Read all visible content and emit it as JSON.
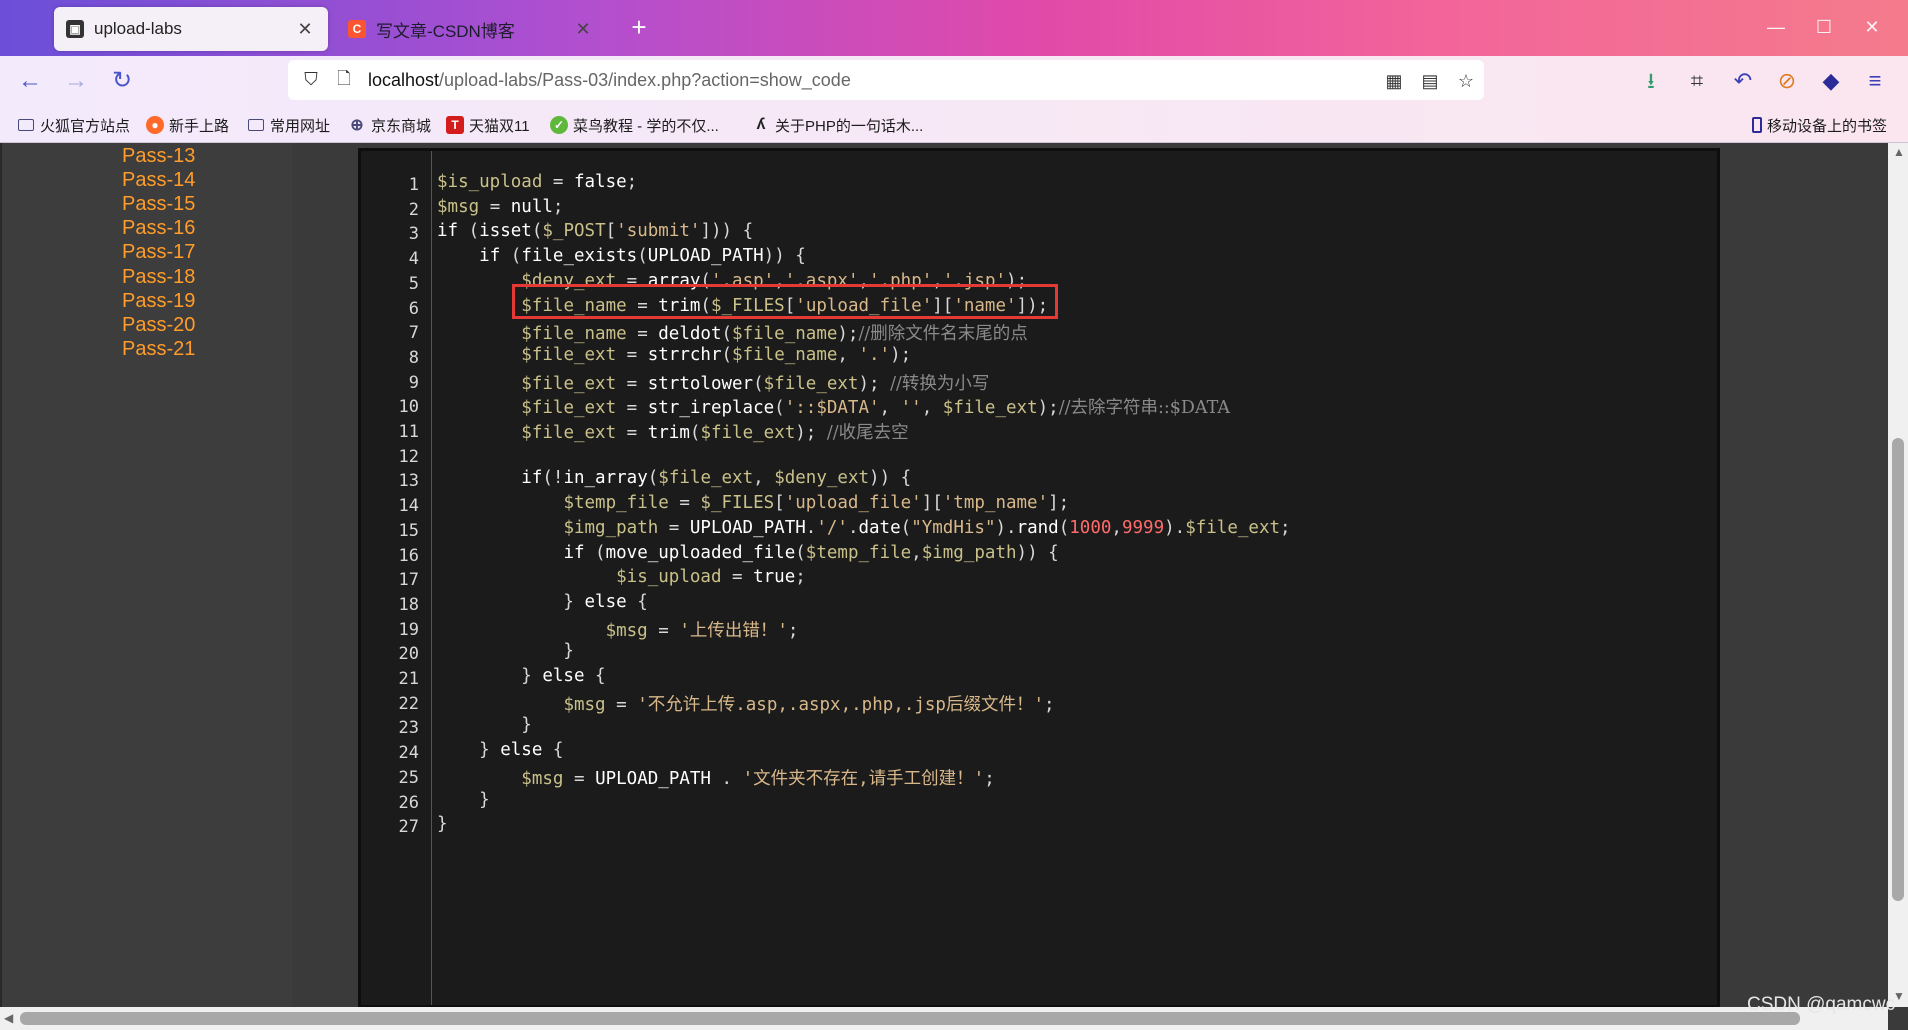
{
  "tabs": [
    {
      "label": "upload-labs",
      "active": true
    },
    {
      "label": "写文章-CSDN博客",
      "active": false
    }
  ],
  "nav": {
    "url_host": "localhost",
    "url_path": "/upload-labs/Pass-03/index.php?action=show_code"
  },
  "bookmarks": [
    {
      "label": "火狐官方站点",
      "icon": "folder-icon"
    },
    {
      "label": "新手上路",
      "icon": "firefox-icon"
    },
    {
      "label": "常用网址",
      "icon": "folder-icon"
    },
    {
      "label": "京东商城",
      "icon": "globe-icon"
    },
    {
      "label": "天猫双11",
      "icon": "tmall-icon"
    },
    {
      "label": "菜鸟教程 - 学的不仅...",
      "icon": "runoob-icon"
    },
    {
      "label": "关于PHP的一句话木...",
      "icon": "wolf-icon"
    },
    {
      "label": "移动设备上的书签",
      "icon": "mobile-icon"
    }
  ],
  "sidebar": {
    "items": [
      "Pass-13",
      "Pass-14",
      "Pass-15",
      "Pass-16",
      "Pass-17",
      "Pass-18",
      "Pass-19",
      "Pass-20",
      "Pass-21"
    ]
  },
  "code": {
    "line_numbers": [
      "1",
      "2",
      "3",
      "4",
      "5",
      "6",
      "7",
      "8",
      "9",
      "10",
      "11",
      "12",
      "13",
      "14",
      "15",
      "16",
      "17",
      "18",
      "19",
      "20",
      "21",
      "22",
      "23",
      "24",
      "25",
      "26",
      "27"
    ],
    "lines": [
      [
        [
          "v",
          "$is_upload"
        ],
        [
          "p",
          " = "
        ],
        [
          "k",
          "false"
        ],
        [
          "p",
          ";"
        ]
      ],
      [
        [
          "v",
          "$msg"
        ],
        [
          "p",
          " = "
        ],
        [
          "k",
          "null"
        ],
        [
          "p",
          ";"
        ]
      ],
      [
        [
          "k",
          "if"
        ],
        [
          "p",
          " ("
        ],
        [
          "k",
          "isset"
        ],
        [
          "p",
          "("
        ],
        [
          "v",
          "$_POST"
        ],
        [
          "p",
          "["
        ],
        [
          "s",
          "'submit'"
        ],
        [
          "p",
          "])) {"
        ]
      ],
      [
        [
          "p",
          "    "
        ],
        [
          "k",
          "if"
        ],
        [
          "p",
          " ("
        ],
        [
          "k",
          "file_exists"
        ],
        [
          "p",
          "("
        ],
        [
          "k",
          "UPLOAD_PATH"
        ],
        [
          "p",
          ")) {"
        ]
      ],
      [
        [
          "p",
          "        "
        ],
        [
          "v",
          "$deny_ext"
        ],
        [
          "p",
          " = "
        ],
        [
          "k",
          "array"
        ],
        [
          "p",
          "("
        ],
        [
          "s",
          "'.asp'"
        ],
        [
          "p",
          ","
        ],
        [
          "s",
          "'.aspx'"
        ],
        [
          "p",
          ","
        ],
        [
          "s",
          "'.php'"
        ],
        [
          "p",
          ","
        ],
        [
          "s",
          "'.jsp'"
        ],
        [
          "p",
          ");"
        ]
      ],
      [
        [
          "p",
          "        "
        ],
        [
          "v",
          "$file_name"
        ],
        [
          "p",
          " = "
        ],
        [
          "k",
          "trim"
        ],
        [
          "p",
          "("
        ],
        [
          "v",
          "$_FILES"
        ],
        [
          "p",
          "["
        ],
        [
          "s",
          "'upload_file'"
        ],
        [
          "p",
          "]["
        ],
        [
          "s",
          "'name'"
        ],
        [
          "p",
          "]);"
        ]
      ],
      [
        [
          "p",
          "        "
        ],
        [
          "v",
          "$file_name"
        ],
        [
          "p",
          " = "
        ],
        [
          "k",
          "deldot"
        ],
        [
          "p",
          "("
        ],
        [
          "v",
          "$file_name"
        ],
        [
          "p",
          ");"
        ],
        [
          "c",
          "//删除文件名末尾的点"
        ]
      ],
      [
        [
          "p",
          "        "
        ],
        [
          "v",
          "$file_ext"
        ],
        [
          "p",
          " = "
        ],
        [
          "k",
          "strrchr"
        ],
        [
          "p",
          "("
        ],
        [
          "v",
          "$file_name"
        ],
        [
          "p",
          ", "
        ],
        [
          "s",
          "'.'"
        ],
        [
          "p",
          ");"
        ]
      ],
      [
        [
          "p",
          "        "
        ],
        [
          "v",
          "$file_ext"
        ],
        [
          "p",
          " = "
        ],
        [
          "k",
          "strtolower"
        ],
        [
          "p",
          "("
        ],
        [
          "v",
          "$file_ext"
        ],
        [
          "p",
          "); "
        ],
        [
          "c",
          "//转换为小写"
        ]
      ],
      [
        [
          "p",
          "        "
        ],
        [
          "v",
          "$file_ext"
        ],
        [
          "p",
          " = "
        ],
        [
          "k",
          "str_ireplace"
        ],
        [
          "p",
          "("
        ],
        [
          "s",
          "'::$DATA'"
        ],
        [
          "p",
          ", "
        ],
        [
          "s",
          "''"
        ],
        [
          "p",
          ", "
        ],
        [
          "v",
          "$file_ext"
        ],
        [
          "p",
          ");"
        ],
        [
          "c",
          "//去除字符串::$DATA"
        ]
      ],
      [
        [
          "p",
          "        "
        ],
        [
          "v",
          "$file_ext"
        ],
        [
          "p",
          " = "
        ],
        [
          "k",
          "trim"
        ],
        [
          "p",
          "("
        ],
        [
          "v",
          "$file_ext"
        ],
        [
          "p",
          "); "
        ],
        [
          "c",
          "//收尾去空"
        ]
      ],
      [],
      [
        [
          "p",
          "        "
        ],
        [
          "k",
          "if"
        ],
        [
          "p",
          "(!"
        ],
        [
          "k",
          "in_array"
        ],
        [
          "p",
          "("
        ],
        [
          "v",
          "$file_ext"
        ],
        [
          "p",
          ", "
        ],
        [
          "v",
          "$deny_ext"
        ],
        [
          "p",
          ")) {"
        ]
      ],
      [
        [
          "p",
          "            "
        ],
        [
          "v",
          "$temp_file"
        ],
        [
          "p",
          " = "
        ],
        [
          "v",
          "$_FILES"
        ],
        [
          "p",
          "["
        ],
        [
          "s",
          "'upload_file'"
        ],
        [
          "p",
          "]["
        ],
        [
          "s",
          "'tmp_name'"
        ],
        [
          "p",
          "];"
        ]
      ],
      [
        [
          "p",
          "            "
        ],
        [
          "v",
          "$img_path"
        ],
        [
          "p",
          " = "
        ],
        [
          "k",
          "UPLOAD_PATH"
        ],
        [
          "p",
          "."
        ],
        [
          "s",
          "'/'"
        ],
        [
          "p",
          "."
        ],
        [
          "k",
          "date"
        ],
        [
          "p",
          "("
        ],
        [
          "s",
          "\"YmdHis\""
        ],
        [
          "p",
          ")."
        ],
        [
          "k",
          "rand"
        ],
        [
          "p",
          "("
        ],
        [
          "n",
          "1000"
        ],
        [
          "p",
          ","
        ],
        [
          "n",
          "9999"
        ],
        [
          "p",
          ")."
        ],
        [
          "v",
          "$file_ext"
        ],
        [
          "p",
          ";"
        ]
      ],
      [
        [
          "p",
          "            "
        ],
        [
          "k",
          "if"
        ],
        [
          "p",
          " ("
        ],
        [
          "k",
          "move_uploaded_file"
        ],
        [
          "p",
          "("
        ],
        [
          "v",
          "$temp_file"
        ],
        [
          "p",
          ","
        ],
        [
          "v",
          "$img_path"
        ],
        [
          "p",
          ")) {"
        ]
      ],
      [
        [
          "p",
          "                 "
        ],
        [
          "v",
          "$is_upload"
        ],
        [
          "p",
          " = "
        ],
        [
          "k",
          "true"
        ],
        [
          "p",
          ";"
        ]
      ],
      [
        [
          "p",
          "            } "
        ],
        [
          "k",
          "else"
        ],
        [
          "p",
          " {"
        ]
      ],
      [
        [
          "p",
          "                "
        ],
        [
          "v",
          "$msg"
        ],
        [
          "p",
          " = "
        ],
        [
          "s",
          "'上传出错！'"
        ],
        [
          "p",
          ";"
        ]
      ],
      [
        [
          "p",
          "            }"
        ]
      ],
      [
        [
          "p",
          "        } "
        ],
        [
          "k",
          "else"
        ],
        [
          "p",
          " {"
        ]
      ],
      [
        [
          "p",
          "            "
        ],
        [
          "v",
          "$msg"
        ],
        [
          "p",
          " = "
        ],
        [
          "s",
          "'不允许上传.asp,.aspx,.php,.jsp后缀文件！'"
        ],
        [
          "p",
          ";"
        ]
      ],
      [
        [
          "p",
          "        }"
        ]
      ],
      [
        [
          "p",
          "    } "
        ],
        [
          "k",
          "else"
        ],
        [
          "p",
          " {"
        ]
      ],
      [
        [
          "p",
          "        "
        ],
        [
          "v",
          "$msg"
        ],
        [
          "p",
          " = "
        ],
        [
          "k",
          "UPLOAD_PATH"
        ],
        [
          "p",
          " . "
        ],
        [
          "s",
          "'文件夹不存在,请手工创建！'"
        ],
        [
          "p",
          ";"
        ]
      ],
      [
        [
          "p",
          "    }"
        ]
      ],
      [
        [
          "p",
          "}"
        ]
      ]
    ]
  },
  "watermark": "CSDN @qamcwc",
  "colors": {
    "sidebar_link": "#ff9c2a",
    "highlight_box": "#e53935",
    "code_bg": "#1b1b1b"
  }
}
